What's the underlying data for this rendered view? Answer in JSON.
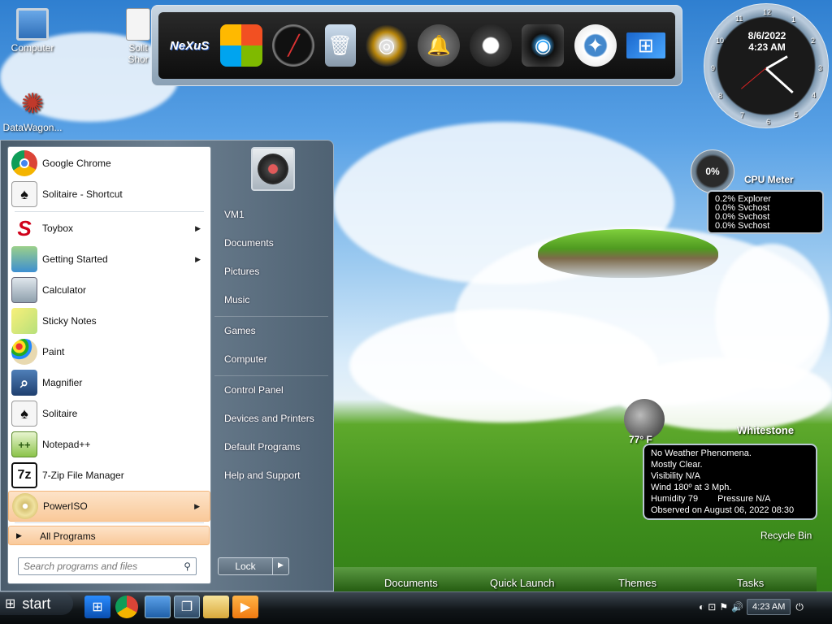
{
  "desktop": {
    "icons": [
      {
        "label": "Computer",
        "icon": "monitor-icon"
      },
      {
        "label": "Solit Shor",
        "icon": "solitaire-shortcut-icon"
      },
      {
        "label": "DataWagon...",
        "icon": "datawagon-icon"
      }
    ],
    "recycle_bin": "Recycle Bin"
  },
  "clock": {
    "date": "8/6/2022",
    "time": "4:23 AM"
  },
  "cpu_meter": {
    "percent": "0%",
    "title": "CPU Meter",
    "processes": [
      "0.2% Explorer",
      "0.0% Svchost",
      "0.0% Svchost",
      "0.0% Svchost"
    ]
  },
  "weather": {
    "temp": "77° F",
    "city": "Whitestone",
    "lines": [
      "No Weather Phenomena.",
      "Mostly Clear.",
      "Visibility N/A",
      "Wind 180º at 3 Mph.",
      "Humidity 79",
      "Observed on August 06, 2022 08:30"
    ],
    "pressure": "Pressure N/A"
  },
  "start_menu": {
    "programs": [
      {
        "label": "Google Chrome",
        "icon": "chrome-icon"
      },
      {
        "label": "Solitaire - Shortcut",
        "icon": "solitaire-icon"
      },
      {
        "label": "Toybox",
        "icon": "toybox-icon",
        "arrow": "▶"
      },
      {
        "label": "Getting Started",
        "icon": "getting-started-icon",
        "arrow": "▶"
      },
      {
        "label": "Calculator",
        "icon": "calculator-icon"
      },
      {
        "label": "Sticky Notes",
        "icon": "sticky-notes-icon"
      },
      {
        "label": "Paint",
        "icon": "paint-icon"
      },
      {
        "label": "Magnifier",
        "icon": "magnifier-icon"
      },
      {
        "label": "Solitaire",
        "icon": "solitaire-icon"
      },
      {
        "label": "Notepad++",
        "icon": "notepadpp-icon"
      },
      {
        "label": "7-Zip File Manager",
        "icon": "7zip-icon"
      },
      {
        "label": "PowerISO",
        "icon": "poweriso-icon",
        "arrow": "▶"
      }
    ],
    "all_programs": "All Programs",
    "search_placeholder": "Search programs and files",
    "right_links": [
      "VM1",
      "Documents",
      "Pictures",
      "Music",
      "Games",
      "Computer",
      "Control Panel",
      "Devices and Printers",
      "Default Programs",
      "Help and Support"
    ],
    "lock": "Lock"
  },
  "link_bar": [
    "Documents",
    "Quick Launch",
    "Themes",
    "Tasks"
  ],
  "taskbar": {
    "start": "start",
    "time": "4:23 AM"
  },
  "colors": {
    "highlight": "#f9c99a",
    "taskbar": "#111619"
  }
}
